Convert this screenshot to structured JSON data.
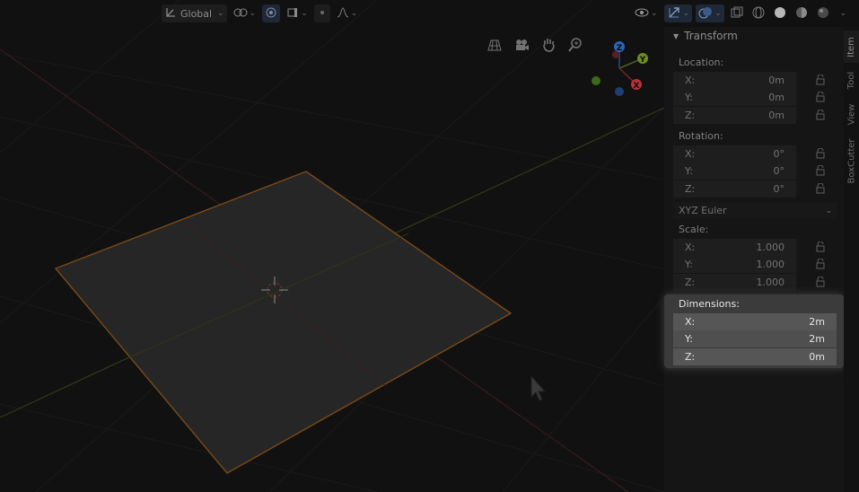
{
  "header": {
    "orientation_label": "Global",
    "icons": [
      "transform-orientation-icon",
      "pivot-point-icon",
      "snap-icon",
      "snap-target-icon",
      "proportional-editing-icon",
      "proportional-falloff-icon",
      "visibility-icon",
      "gizmo-toggle-icon",
      "overlay-toggle-icon",
      "xray-toggle-icon",
      "shading-wireframe-icon",
      "shading-solid-icon",
      "shading-material-icon",
      "shading-rendered-icon"
    ]
  },
  "navigation": {
    "icons": [
      "grid-view-icon",
      "camera-icon",
      "pan-hand-icon",
      "zoom-icon"
    ]
  },
  "gizmo": {
    "x_label": "X",
    "y_label": "Y",
    "z_label": "Z",
    "colors": {
      "x": "#b83238",
      "y": "#6c8c24",
      "z": "#2a66b8"
    }
  },
  "panel": {
    "title": "Transform",
    "location": {
      "label": "Location:",
      "fields": [
        {
          "axis": "X:",
          "value": "0m"
        },
        {
          "axis": "Y:",
          "value": "0m"
        },
        {
          "axis": "Z:",
          "value": "0m"
        }
      ]
    },
    "rotation": {
      "label": "Rotation:",
      "fields": [
        {
          "axis": "X:",
          "value": "0°"
        },
        {
          "axis": "Y:",
          "value": "0°"
        },
        {
          "axis": "Z:",
          "value": "0°"
        }
      ]
    },
    "rotation_mode": "XYZ Euler",
    "scale": {
      "label": "Scale:",
      "fields": [
        {
          "axis": "X:",
          "value": "1.000"
        },
        {
          "axis": "Y:",
          "value": "1.000"
        },
        {
          "axis": "Z:",
          "value": "1.000"
        }
      ]
    },
    "dimensions": {
      "label": "Dimensions:",
      "fields": [
        {
          "axis": "X:",
          "value": "2m"
        },
        {
          "axis": "Y:",
          "value": "2m"
        },
        {
          "axis": "Z:",
          "value": "0m"
        }
      ]
    }
  },
  "tabs": [
    "Item",
    "Tool",
    "View",
    "BoxCutter"
  ],
  "colors": {
    "selection_outline": "#a0601c",
    "x_axis": "#4a1e20",
    "y_axis": "#3e4a16",
    "accent": "#2a66b8"
  }
}
